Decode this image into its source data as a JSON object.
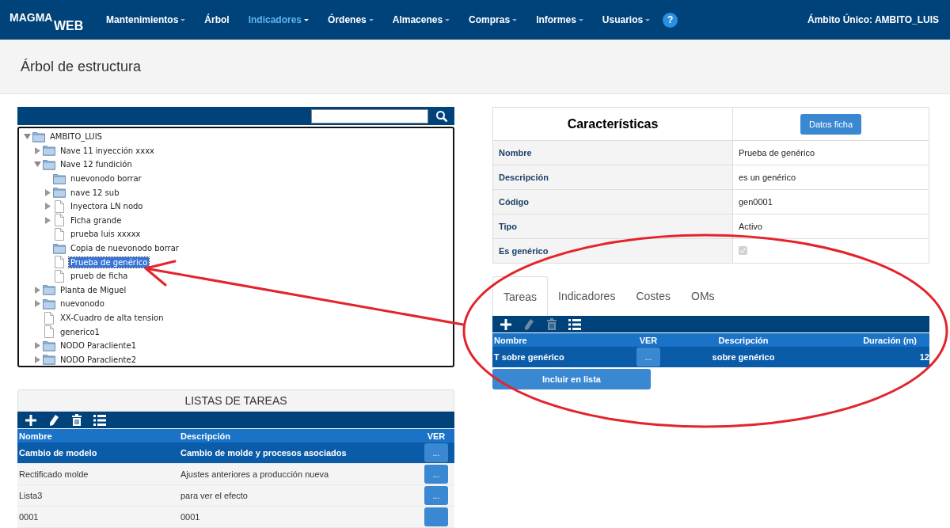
{
  "navbar": {
    "logo": {
      "main": "MAGMA",
      "sub": "WEB"
    },
    "menu": [
      {
        "label": "Mantenimientos",
        "dropdown": true,
        "selected": false
      },
      {
        "label": "Árbol",
        "dropdown": false,
        "selected": false
      },
      {
        "label": "Indicadores",
        "dropdown": true,
        "selected": true
      },
      {
        "label": "Órdenes",
        "dropdown": true,
        "selected": false
      },
      {
        "label": "Almacenes",
        "dropdown": true,
        "selected": false
      },
      {
        "label": "Compras",
        "dropdown": true,
        "selected": false
      },
      {
        "label": "Informes",
        "dropdown": true,
        "selected": false
      },
      {
        "label": "Usuarios",
        "dropdown": true,
        "selected": false
      }
    ],
    "help": "?",
    "scope": "Ámbito Único: AMBITO_LUIS"
  },
  "page_title": "Árbol de estructura",
  "tree": {
    "items": [
      {
        "label": "AMBITO_LUIS",
        "kind": "folder",
        "expanded": true,
        "selected": false,
        "children": [
          {
            "label": "Nave 11 inyección xxxx",
            "kind": "folder",
            "expanded": false,
            "selected": false
          },
          {
            "label": "Nave 12 fundición",
            "kind": "folder",
            "expanded": true,
            "selected": false,
            "children": [
              {
                "label": "nuevonodo borrar",
                "kind": "folder",
                "selected": false
              },
              {
                "label": "nave 12 sub",
                "kind": "folder",
                "expanded": false,
                "selected": false
              },
              {
                "label": "Inyectora LN nodo",
                "kind": "file",
                "expanded": false,
                "selected": false
              },
              {
                "label": "Ficha grande",
                "kind": "file",
                "expanded": false,
                "selected": false
              },
              {
                "label": "prueba luis xxxxx",
                "kind": "file",
                "selected": false
              },
              {
                "label": "Copia de nuevonodo borrar",
                "kind": "folder",
                "selected": false
              },
              {
                "label": "Prueba de genérico",
                "kind": "file",
                "selected": true
              },
              {
                "label": "prueb de ficha",
                "kind": "file",
                "selected": false
              }
            ]
          },
          {
            "label": "Planta de Miguel",
            "kind": "folder",
            "expanded": false,
            "selected": false
          },
          {
            "label": "nuevonodo",
            "kind": "folder",
            "expanded": false,
            "selected": false
          },
          {
            "label": "XX-Cuadro de alta tension",
            "kind": "file",
            "selected": false
          },
          {
            "label": "generico1",
            "kind": "file",
            "selected": false
          },
          {
            "label": "NODO Paracliente1",
            "kind": "folder",
            "expanded": false,
            "selected": false
          },
          {
            "label": "NODO Paracliente2",
            "kind": "folder",
            "expanded": false,
            "selected": false
          }
        ]
      }
    ]
  },
  "task_lists": {
    "title": "LISTAS DE TAREAS",
    "toolbar": [
      {
        "kind": "add",
        "disabled": false
      },
      {
        "kind": "edit",
        "disabled": false
      },
      {
        "kind": "delete",
        "disabled": false
      },
      {
        "kind": "list",
        "disabled": false
      }
    ],
    "columns": [
      "Nombre",
      "Descripción",
      "VER"
    ],
    "rows": [
      {
        "name": "Cambio de modelo",
        "description": "Cambio de molde y procesos asociados",
        "view": "...",
        "selected": true
      },
      {
        "name": "Rectificado molde",
        "description": "Ajustes anteriores a producción nueva",
        "view": "...",
        "selected": false
      },
      {
        "name": "Lista3",
        "description": "para ver el efecto",
        "view": "...",
        "selected": false
      },
      {
        "name": "0001",
        "description": "0001",
        "selected": false
      }
    ]
  },
  "characteristics": {
    "title": "Características",
    "button": "Datos ficha",
    "rows": [
      {
        "label": "Nombre",
        "kind": "text",
        "value": "Prueba de genérico"
      },
      {
        "label": "Descripción",
        "kind": "text",
        "value": "es un genérico"
      },
      {
        "label": "Código",
        "kind": "text",
        "value": "gen0001"
      },
      {
        "label": "Tipo",
        "kind": "text",
        "value": "Activo"
      },
      {
        "label": "Es genérico",
        "kind": "checkbox",
        "checked": true,
        "disabled": true
      }
    ]
  },
  "tabs": [
    {
      "label": "Tareas",
      "selected": true
    },
    {
      "label": "Indicadores",
      "selected": false
    },
    {
      "label": "Costes",
      "selected": false
    },
    {
      "label": "OMs",
      "selected": false
    }
  ],
  "tasks": {
    "toolbar": [
      {
        "kind": "add",
        "disabled": false
      },
      {
        "kind": "edit",
        "disabled": true
      },
      {
        "kind": "delete",
        "disabled": true
      },
      {
        "kind": "list",
        "disabled": false
      }
    ],
    "columns": [
      "Nombre",
      "VER",
      "Descripción",
      "Duración (m)"
    ],
    "rows": [
      {
        "name": "T sobre genérico",
        "view": "...",
        "description": "sobre genérico",
        "duration": "12",
        "selected": true
      }
    ],
    "button": "Incluir en lista"
  }
}
